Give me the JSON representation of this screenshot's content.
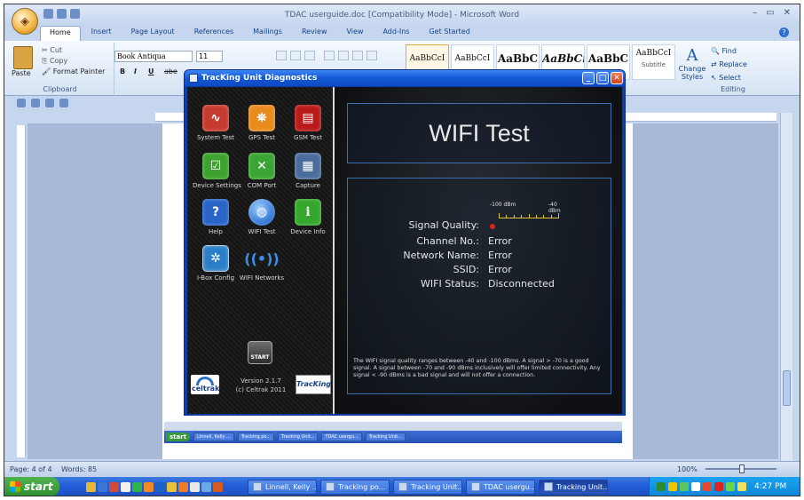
{
  "word": {
    "window_title": "TDAC userguide.doc [Compatibility Mode] - Microsoft Word",
    "office_button": "",
    "tabs": [
      {
        "label": "Home",
        "active": true
      },
      {
        "label": "Insert"
      },
      {
        "label": "Page Layout"
      },
      {
        "label": "References"
      },
      {
        "label": "Mailings"
      },
      {
        "label": "Review"
      },
      {
        "label": "View"
      },
      {
        "label": "Add-Ins"
      },
      {
        "label": "Get Started"
      }
    ],
    "clipboard": {
      "paste": "Paste",
      "cut": "Cut",
      "copy": "Copy",
      "format_painter": "Format Painter",
      "group_label": "Clipboard"
    },
    "font": {
      "name": "Book Antiqua",
      "size": "11",
      "bold": "B",
      "italic": "I",
      "underline": "U",
      "strike": "abe"
    },
    "styles": [
      {
        "label": "AaBbCcI",
        "selected": true
      },
      {
        "label": "AaBbCcI"
      },
      {
        "label": "AaBbC",
        "big": true
      },
      {
        "label": "AaBbCı",
        "italic": true
      },
      {
        "label": "AaBbC",
        "big": true
      },
      {
        "label": "AaBbCcI",
        "sub": "Subtitle"
      }
    ],
    "change_styles": "Change Styles",
    "editing": {
      "find": "Find",
      "replace": "Replace",
      "select": "Select",
      "group_label": "Editing"
    },
    "status": {
      "page": "Page: 4 of 4",
      "words": "Words: 85",
      "zoom": "100%"
    }
  },
  "taskbar": {
    "start": "start",
    "buttons": [
      {
        "label": "Linnell, Kelly ..."
      },
      {
        "label": "Tracking po..."
      },
      {
        "label": "Tracking Unit..."
      },
      {
        "label": "TDAC usergu..."
      },
      {
        "label": "Tracking Unit...",
        "active": true
      }
    ],
    "clock": "4:27 PM"
  },
  "mini_taskbar": {
    "start": "start",
    "buttons": [
      "Linnell, Kelly ...",
      "Tracking po...",
      "Tracking Unit...",
      "TDAC usergu...",
      "Tracking Unit..."
    ]
  },
  "diag": {
    "title": "TracKing Unit Diagnostics",
    "tiles": [
      {
        "label": "System Test",
        "icon": "system-test-icon",
        "color": "#c73a2e",
        "glyph": "∿"
      },
      {
        "label": "GPS Test",
        "icon": "gps-icon",
        "color": "#e98a1f",
        "glyph": "⛯"
      },
      {
        "label": "GSM Test",
        "icon": "gsm-icon",
        "color": "#b91a1a",
        "glyph": "▤"
      },
      {
        "label": "Device Settings",
        "icon": "device-settings-icon",
        "color": "#3da22f",
        "glyph": "☑"
      },
      {
        "label": "COM Port",
        "icon": "com-port-icon",
        "color": "#3aa532",
        "glyph": "✕"
      },
      {
        "label": "Capture",
        "icon": "capture-icon",
        "color": "#4b6d9c",
        "glyph": "▦"
      },
      {
        "label": "Help",
        "icon": "help-icon",
        "color": "#2a64c9",
        "glyph": "?"
      },
      {
        "label": "WIFI Test",
        "icon": "globe-icon",
        "color": "#3d86dc",
        "glyph": "◍"
      },
      {
        "label": "Device Info",
        "icon": "info-icon",
        "color": "#36a62c",
        "glyph": "i"
      },
      {
        "label": "I-Box Config",
        "icon": "ibox-config-icon",
        "color": "#2b7fc8",
        "glyph": "✲"
      },
      {
        "label": "WIFI Networks",
        "icon": "wifi-networks-icon",
        "color": "transparent",
        "glyph": "))"
      }
    ],
    "start_button": "START",
    "version": "Version 2.1.7",
    "copyright": "(c) Celtrak 2011",
    "celtrak_logo": "celtrak",
    "tracking_logo": "TracKing",
    "heading": "WIFI Test",
    "meter": {
      "low": "-100 dBm",
      "high": "-40 dBm"
    },
    "rows": [
      {
        "label": "Signal Quality:",
        "value": ""
      },
      {
        "label": "Channel No.:",
        "value": "Error"
      },
      {
        "label": "Network Name:",
        "value": "Error"
      },
      {
        "label": "SSID:",
        "value": "Error"
      },
      {
        "label": "WIFI Status:",
        "value": "Disconnected"
      }
    ],
    "note": "The WIFI signal quality ranges between -40 and -100 dBms. A signal > -70 is a good signal. A signal between -70 and -90 dBms inclusively will offer limited connectivity. Any signal < -90 dBms is a bad signal and will not offer a connection."
  }
}
